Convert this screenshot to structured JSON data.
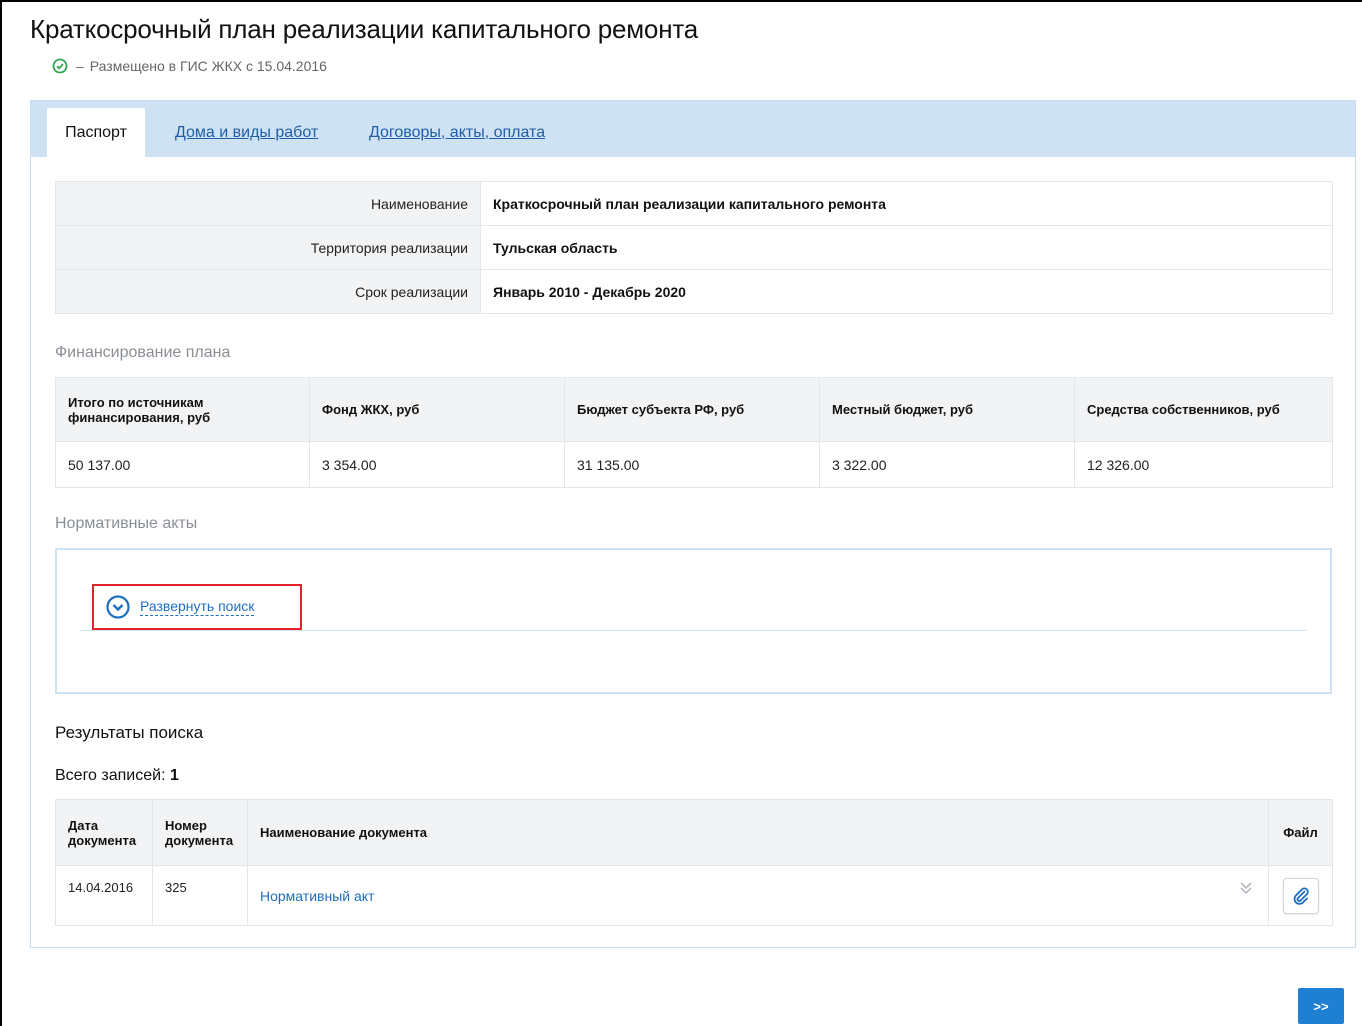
{
  "page": {
    "title": "Краткосрочный план реализации капитального ремонта",
    "status_dash": "–",
    "status_text": "Размещено в ГИС ЖКХ с 15.04.2016"
  },
  "tabs": [
    {
      "label": "Паспорт",
      "active": true
    },
    {
      "label": "Дома и виды работ",
      "active": false
    },
    {
      "label": "Договоры, акты, оплата",
      "active": false
    }
  ],
  "info": [
    {
      "label": "Наименование",
      "value": "Краткосрочный план реализации капитального ремонта"
    },
    {
      "label": "Территория реализации",
      "value": "Тульская область"
    },
    {
      "label": "Срок реализации",
      "value": "Январь 2010  - Декабрь 2020"
    }
  ],
  "financing": {
    "title": "Финансирование плана",
    "headers": [
      "Итого по источникам финансирования, руб",
      "Фонд ЖКХ, руб",
      "Бюджет субъекта РФ, руб",
      "Местный бюджет, руб",
      "Средства собственников, руб"
    ],
    "row": [
      "50 137.00",
      "3 354.00",
      "31 135.00",
      "3 322.00",
      "12 326.00"
    ]
  },
  "acts": {
    "title": "Нормативные акты",
    "expand_label": "Развернуть поиск"
  },
  "results": {
    "title": "Результаты поиска",
    "total_label": "Всего записей:",
    "total_value": "1",
    "headers": [
      "Дата документа",
      "Номер документа",
      "Наименование документа",
      "Файл"
    ],
    "rows": [
      {
        "date": "14.04.2016",
        "number": "325",
        "name": "Нормативный акт"
      }
    ]
  },
  "nav": {
    "next_label": ">>"
  },
  "colors": {
    "accent": "#1f7fd3",
    "tab_bar": "#cfe2f3",
    "link": "#1f6fc0",
    "highlight": "#e0242a",
    "ok": "#2fa84f"
  }
}
